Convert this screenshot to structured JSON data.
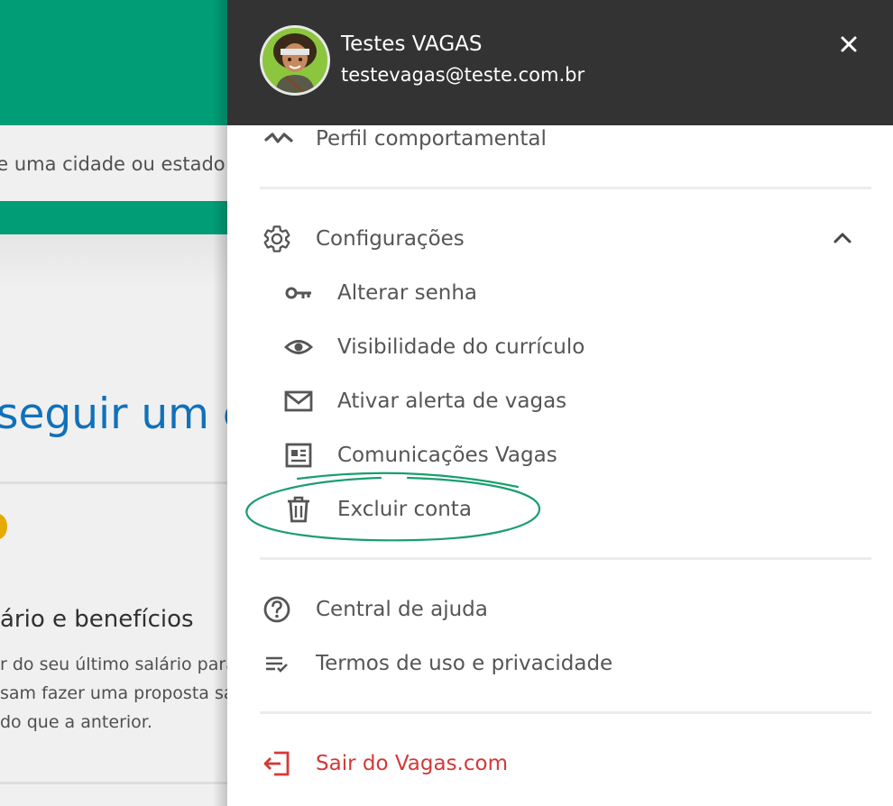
{
  "background": {
    "search_placeholder": "te uma cidade ou estado",
    "hero_text": "seguir um en",
    "card_title": "ário e benefícios",
    "card_lines": [
      "r do seu último salário para",
      "sam fazer uma proposta sa",
      "do que a anterior."
    ]
  },
  "drawer": {
    "user": {
      "name": "Testes VAGAS",
      "email": "testevagas@teste.com.br",
      "avatar_icon": "avatar-illustration"
    },
    "close_icon": "close-icon",
    "items": {
      "profile": {
        "label": "Perfil comportamental",
        "icon": "pulse-icon"
      },
      "settings": {
        "label": "Configurações",
        "icon": "gear-icon",
        "expanded": true
      },
      "change_password": {
        "label": "Alterar senha",
        "icon": "key-icon"
      },
      "visibility": {
        "label": "Visibilidade do currículo",
        "icon": "eye-icon"
      },
      "job_alert": {
        "label": "Ativar alerta de vagas",
        "icon": "mail-icon"
      },
      "communications": {
        "label": "Comunicações Vagas",
        "icon": "newspaper-icon"
      },
      "delete_account": {
        "label": "Excluir conta",
        "icon": "trash-icon",
        "highlighted": true
      },
      "help": {
        "label": "Central de ajuda",
        "icon": "help-circle-icon"
      },
      "terms": {
        "label": "Termos de uso e privacidade",
        "icon": "list-check-icon"
      },
      "logout": {
        "label": "Sair do Vagas.com",
        "icon": "logout-icon"
      }
    }
  },
  "colors": {
    "brand_green": "#00a77e",
    "header_dark": "#333333",
    "hero_blue": "#1279c6",
    "logout_red": "#d53838",
    "annotation_green": "#1a9e6e"
  }
}
